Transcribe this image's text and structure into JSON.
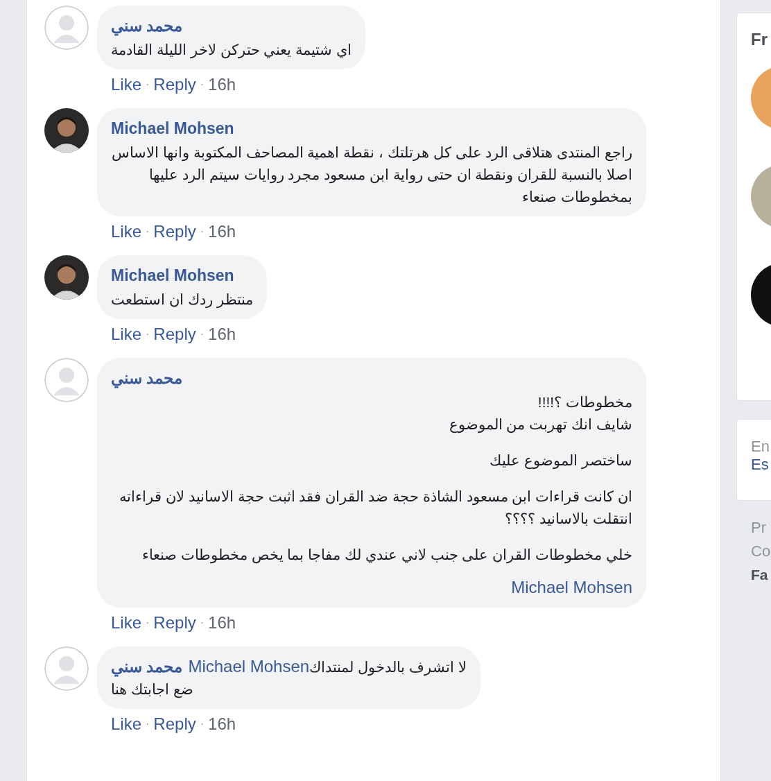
{
  "comments": [
    {
      "author": "محمد سني",
      "kind": "default",
      "paragraphs": [
        [
          "اي شتيمة يعني حتركن لاخر الليلة القادمة"
        ]
      ],
      "meta": {
        "like": "Like",
        "sep1": "·",
        "reply": "Reply",
        "sep2": "·",
        "time": "16h"
      }
    },
    {
      "author": "Michael Mohsen",
      "paragraphs": [
        [
          "راجع المنتدى هتلاقى الرد على كل هرتلتك ، نقطة اهمية المصاحف المكتوبة وانها الاساس اصلا بالنسبة للقران ونقطة ان حتى رواية ابن مسعود مجرد روايات سيتم الرد عليها بمخطوطات صنعاء"
        ]
      ],
      "meta": {
        "like": "Like",
        "sep1": "·",
        "reply": "Reply",
        "sep2": "·",
        "time": "16h"
      }
    },
    {
      "author": "Michael Mohsen",
      "paragraphs": [
        [
          "منتظر ردك ان استطعت"
        ]
      ],
      "meta": {
        "like": "Like",
        "sep1": "·",
        "reply": "Reply",
        "sep2": "·",
        "time": "16h"
      }
    },
    {
      "author": "محمد سني",
      "kind": "default",
      "paragraphs": [
        [
          "مخطوطات ؟!!!!",
          "شايف انك تهربت من الموضوع"
        ],
        [
          "ساختصر الموضوع عليك"
        ],
        [
          "ان كانت قراءات ابن مسعود الشاذة حجة ضد القران فقد اثبت حجة الاسانيد لان قراءاته انتقلت بالاسانيد ؟؟؟؟"
        ],
        [
          "خلي مخطوطات القران على جنب لاني عندي لك مفاجا بما يخص مخطوطات صنعاء"
        ]
      ],
      "link": "Michael Mohsen",
      "meta": {
        "like": "Like",
        "sep1": "·",
        "reply": "Reply",
        "sep2": "·",
        "time": "16h"
      }
    },
    {
      "author": "محمد سني",
      "kind": "default",
      "mention": "Michael Mohsen",
      "paragraphs": [
        [
          "لا اتشرف بالدخول لمنتداك",
          "ضع اجابتك هنا"
        ]
      ],
      "meta": {
        "like": "Like",
        "sep1": "·",
        "reply": "Reply",
        "sep2": "·",
        "time": "16h"
      }
    }
  ],
  "sidebar": {
    "cards": [
      {
        "kind": "people",
        "title": "Fr"
      },
      {
        "kind": "language",
        "current": "En",
        "option": "Es"
      }
    ],
    "footer": [
      "Pr",
      "Co"
    ],
    "footer_bold": "Fa"
  }
}
